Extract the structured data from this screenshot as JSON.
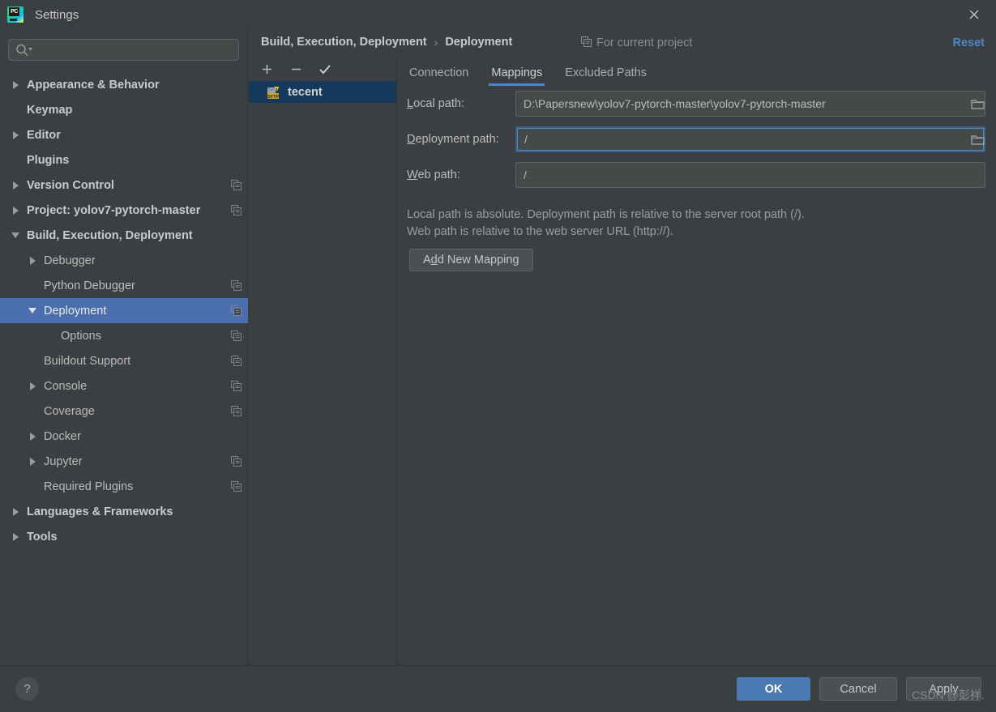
{
  "window": {
    "title": "Settings",
    "app_icon": "pycharm-icon",
    "close_icon": "close-icon"
  },
  "search": {
    "placeholder": "",
    "value": "",
    "icon": "search-icon"
  },
  "sidebar": {
    "items": [
      {
        "label": "Appearance & Behavior",
        "level": 0,
        "arrow": "right",
        "bold": true,
        "copy_icon": false,
        "selected": false
      },
      {
        "label": "Keymap",
        "level": 0,
        "arrow": "none",
        "bold": true,
        "copy_icon": false,
        "selected": false
      },
      {
        "label": "Editor",
        "level": 0,
        "arrow": "right",
        "bold": true,
        "copy_icon": false,
        "selected": false
      },
      {
        "label": "Plugins",
        "level": 0,
        "arrow": "none",
        "bold": true,
        "copy_icon": false,
        "selected": false
      },
      {
        "label": "Version Control",
        "level": 0,
        "arrow": "right",
        "bold": true,
        "copy_icon": true,
        "selected": false
      },
      {
        "label": "Project: yolov7-pytorch-master",
        "level": 0,
        "arrow": "right",
        "bold": true,
        "copy_icon": true,
        "selected": false
      },
      {
        "label": "Build, Execution, Deployment",
        "level": 0,
        "arrow": "down",
        "bold": true,
        "copy_icon": false,
        "selected": false
      },
      {
        "label": "Debugger",
        "level": 1,
        "arrow": "right",
        "bold": false,
        "copy_icon": false,
        "selected": false
      },
      {
        "label": "Python Debugger",
        "level": 1,
        "arrow": "none",
        "bold": false,
        "copy_icon": true,
        "selected": false
      },
      {
        "label": "Deployment",
        "level": 1,
        "arrow": "down",
        "bold": false,
        "copy_icon": true,
        "selected": true
      },
      {
        "label": "Options",
        "level": 2,
        "arrow": "none",
        "bold": false,
        "copy_icon": true,
        "selected": false
      },
      {
        "label": "Buildout Support",
        "level": 1,
        "arrow": "none",
        "bold": false,
        "copy_icon": true,
        "selected": false
      },
      {
        "label": "Console",
        "level": 1,
        "arrow": "right",
        "bold": false,
        "copy_icon": true,
        "selected": false
      },
      {
        "label": "Coverage",
        "level": 1,
        "arrow": "none",
        "bold": false,
        "copy_icon": true,
        "selected": false
      },
      {
        "label": "Docker",
        "level": 1,
        "arrow": "right",
        "bold": false,
        "copy_icon": false,
        "selected": false
      },
      {
        "label": "Jupyter",
        "level": 1,
        "arrow": "right",
        "bold": false,
        "copy_icon": true,
        "selected": false
      },
      {
        "label": "Required Plugins",
        "level": 1,
        "arrow": "none",
        "bold": false,
        "copy_icon": true,
        "selected": false
      },
      {
        "label": "Languages & Frameworks",
        "level": 0,
        "arrow": "right",
        "bold": true,
        "copy_icon": false,
        "selected": false
      },
      {
        "label": "Tools",
        "level": 0,
        "arrow": "right",
        "bold": true,
        "copy_icon": false,
        "selected": false
      }
    ]
  },
  "header": {
    "breadcrumb": [
      "Build, Execution, Deployment",
      "Deployment"
    ],
    "separator": "›",
    "project_scope_label": "For current project",
    "project_scope_icon": "copy-settings-icon",
    "reset_label": "Reset"
  },
  "server_panel": {
    "toolbar": [
      {
        "name": "add-server-button",
        "glyph": "+"
      },
      {
        "name": "remove-server-button",
        "glyph": "−"
      },
      {
        "name": "set-default-button",
        "glyph": "✓"
      }
    ],
    "servers": [
      {
        "name": "tecent",
        "icon": "sftp-warning-icon",
        "selected": true
      }
    ]
  },
  "tabs": [
    {
      "label": "Connection",
      "active": false
    },
    {
      "label": "Mappings",
      "active": true
    },
    {
      "label": "Excluded Paths",
      "active": false
    }
  ],
  "form": {
    "fields": [
      {
        "label_pre": "",
        "label_mnemonic": "L",
        "label_post": "ocal path:",
        "value": "D:\\Papersnew\\yolov7-pytorch-master\\yolov7-pytorch-master",
        "placeholder": "",
        "browse_icon": true,
        "focused": false
      },
      {
        "label_pre": "",
        "label_mnemonic": "D",
        "label_post": "eployment path:",
        "value": "/",
        "placeholder": "",
        "browse_icon": true,
        "focused": true
      },
      {
        "label_pre": "",
        "label_mnemonic": "W",
        "label_post": "eb path:",
        "value": "/",
        "placeholder": "",
        "browse_icon": false,
        "focused": false
      }
    ],
    "help_line_1": "Local path is absolute. Deployment path is relative to the server root path (/).",
    "help_line_2": "Web path is relative to the web server URL (http://).",
    "add_mapping_pre": "A",
    "add_mapping_mnemonic": "d",
    "add_mapping_post": "d New Mapping"
  },
  "footer": {
    "help_glyph": "?",
    "ok_label": "OK",
    "cancel_label": "Cancel",
    "apply_label": "Apply"
  },
  "watermark": "CSDN @彭祥.",
  "colors": {
    "background": "#3c3f41",
    "panel": "#45494a",
    "selection": "#4b6eaf",
    "server_selection": "#15395b",
    "accent": "#4a88c7",
    "ok_button": "#4a7ab1",
    "text": "#bbbbbb"
  }
}
